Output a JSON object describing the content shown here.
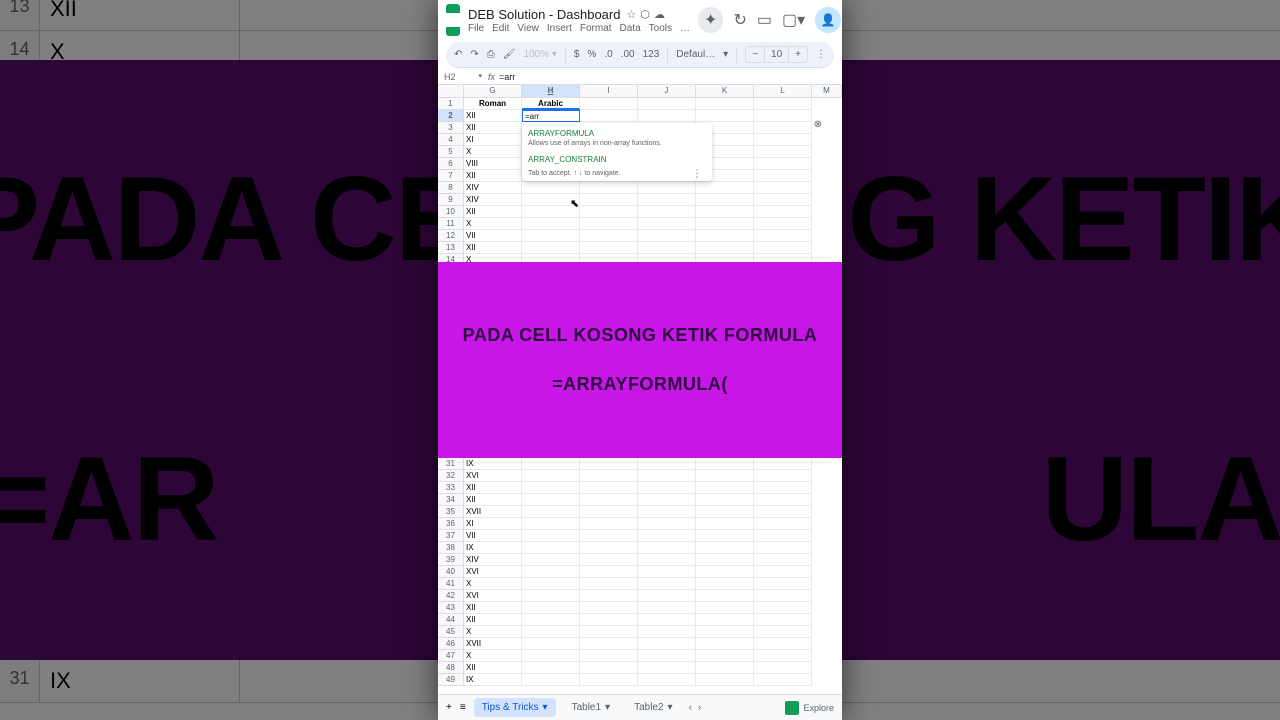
{
  "bg": {
    "row13": {
      "num": "13",
      "val": "XII"
    },
    "row14": {
      "num": "14",
      "val": "X"
    },
    "row31": {
      "num": "31",
      "val": "IX"
    },
    "text1a": "PADA CE",
    "text1b": "G KETIK",
    "text2a": "=AR",
    "text2b": "ULA("
  },
  "doc": {
    "title": "DEB Solution - Dashboard",
    "menus": [
      "File",
      "Edit",
      "View",
      "Insert",
      "Format",
      "Data",
      "Tools",
      "…"
    ]
  },
  "toolbar": {
    "font": "Defaul…",
    "fontsize": "10",
    "currency": "$",
    "percent": "%",
    "decimals1": ".0",
    "decimals2": ".00",
    "num123": "123"
  },
  "namebox": {
    "cell": "H2",
    "formula": "=arr"
  },
  "columns": [
    "G",
    "H",
    "I",
    "J",
    "K",
    "L",
    "M"
  ],
  "header_row": {
    "num": "1",
    "g": "Roman",
    "h": "Arabic"
  },
  "edit_cell": "=arr",
  "rows_top": [
    {
      "n": "2",
      "v": "XII"
    },
    {
      "n": "3",
      "v": "XII"
    },
    {
      "n": "4",
      "v": "XI"
    },
    {
      "n": "5",
      "v": "X"
    },
    {
      "n": "6",
      "v": "VIII"
    },
    {
      "n": "7",
      "v": "XII"
    },
    {
      "n": "8",
      "v": "XIV"
    },
    {
      "n": "9",
      "v": "XIV"
    },
    {
      "n": "10",
      "v": "XII"
    },
    {
      "n": "11",
      "v": "X"
    },
    {
      "n": "12",
      "v": "VII"
    },
    {
      "n": "13",
      "v": "XII"
    },
    {
      "n": "14",
      "v": "X"
    }
  ],
  "rows_bottom": [
    {
      "n": "31",
      "v": "IX"
    },
    {
      "n": "32",
      "v": "XVI"
    },
    {
      "n": "33",
      "v": "XII"
    },
    {
      "n": "34",
      "v": "XII"
    },
    {
      "n": "35",
      "v": "XVII"
    },
    {
      "n": "36",
      "v": "XI"
    },
    {
      "n": "37",
      "v": "VII"
    },
    {
      "n": "38",
      "v": "IX"
    },
    {
      "n": "39",
      "v": "XIV"
    },
    {
      "n": "40",
      "v": "XVI"
    },
    {
      "n": "41",
      "v": "X"
    },
    {
      "n": "42",
      "v": "XVI"
    },
    {
      "n": "43",
      "v": "XII"
    },
    {
      "n": "44",
      "v": "XII"
    },
    {
      "n": "45",
      "v": "X"
    },
    {
      "n": "46",
      "v": "XVII"
    },
    {
      "n": "47",
      "v": "X"
    },
    {
      "n": "48",
      "v": "XII"
    },
    {
      "n": "49",
      "v": "IX"
    }
  ],
  "autocomplete": {
    "item1": "ARRAYFORMULA",
    "desc": "Allows use of arrays in non-array functions.",
    "item2": "ARRAY_CONSTRAIN",
    "hint": "Tab  to accept.  ↑  ↓  to navigate."
  },
  "overlay": {
    "line1": "PADA CELL KOSONG KETIK FORMULA",
    "line2": "=ARRAYFORMULA("
  },
  "tabs": {
    "add": "+",
    "all": "≡",
    "t1": "Tips & Tricks",
    "t2": "Table1",
    "t3": "Table2",
    "explore": "Explore"
  }
}
